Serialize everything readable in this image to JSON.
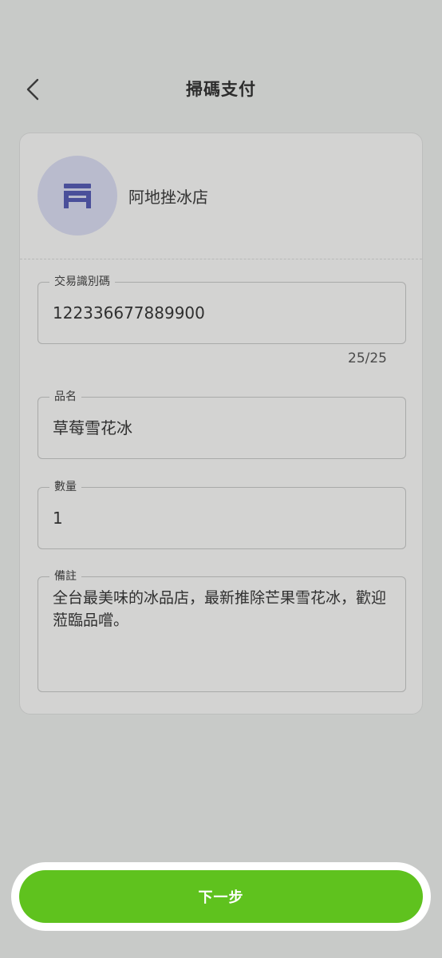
{
  "header": {
    "title": "掃碼支付",
    "back_icon": "chevron-left-icon"
  },
  "store": {
    "icon": "storefront-icon",
    "name": "阿地挫冰店",
    "avatar_color": "#b9bbcd",
    "icon_color": "#4a4f9a"
  },
  "form": {
    "transaction_id": {
      "label": "交易識別碼",
      "value": "122336677889900",
      "counter": "25/25"
    },
    "product_name": {
      "label": "品名",
      "value": "草莓雪花冰"
    },
    "quantity": {
      "label": "數量",
      "value": "1"
    },
    "note": {
      "label": "備註",
      "value": "全台最美味的冰品店，最新推除芒果雪花冰，歡迎蒞臨品嚐。"
    }
  },
  "footer": {
    "next_label": "下一步",
    "accent_color": "#5fc21e"
  }
}
